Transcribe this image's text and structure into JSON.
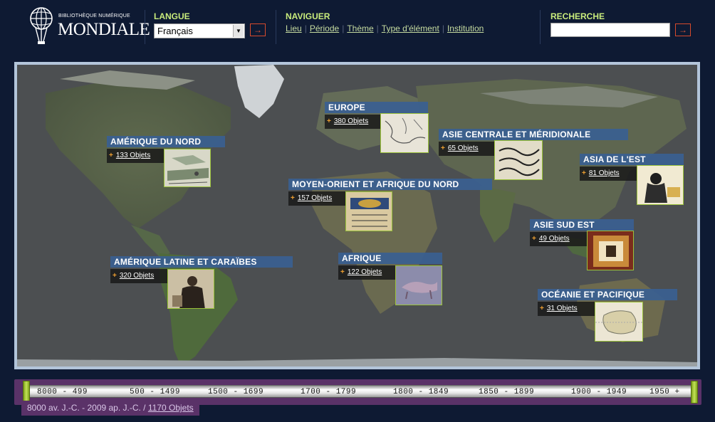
{
  "header": {
    "logo": {
      "top": "BIBLIOTHÈQUE NUMÉRIQUE",
      "main": "MONDIALE"
    },
    "language": {
      "label": "LANGUE",
      "selected": "Français",
      "go": "→"
    },
    "navigate": {
      "label": "NAVIGUER",
      "links": [
        "Lieu",
        "Période",
        "Thème",
        "Type d'élément",
        "Institution"
      ]
    },
    "search": {
      "label": "RECHERCHE",
      "value": "",
      "go": "→"
    }
  },
  "regions": [
    {
      "name": "AMÉRIQUE DU NORD",
      "count": "133 Objets"
    },
    {
      "name": "EUROPE",
      "count": "380 Objets"
    },
    {
      "name": "ASIE CENTRALE ET MÉRIDIONALE",
      "count": "65 Objets"
    },
    {
      "name": "ASIA DE L'EST",
      "count": "81 Objets"
    },
    {
      "name": "MOYEN-ORIENT ET AFRIQUE DU NORD",
      "count": "157 Objets"
    },
    {
      "name": "ASIE SUD EST",
      "count": "49 Objets"
    },
    {
      "name": "AMÉRIQUE LATINE ET CARAÏBES",
      "count": "320 Objets"
    },
    {
      "name": "AFRIQUE",
      "count": "122 Objets"
    },
    {
      "name": "OCÉANIE ET PACIFIQUE",
      "count": "31 Objets"
    }
  ],
  "region_plus": "+",
  "timeline": {
    "periods": [
      "8000 - 499",
      "500 - 1499",
      "1500 - 1699",
      "1700 - 1799",
      "1800 - 1849",
      "1850 - 1899",
      "1900 - 1949",
      "1950 +"
    ],
    "summary_range": "8000 av. J.-C. - 2009 ap. J.-C. / ",
    "summary_count": "1170 Objets"
  },
  "colors": {
    "background": "#0e1a33",
    "section_label": "#c9ec7c",
    "nav_link": "#c6dca0",
    "accent_red": "#d74a2c",
    "region_title_bg": "#3a5f91",
    "thumb_border": "#9bc23a",
    "timeline_bg": "#5a3268"
  }
}
